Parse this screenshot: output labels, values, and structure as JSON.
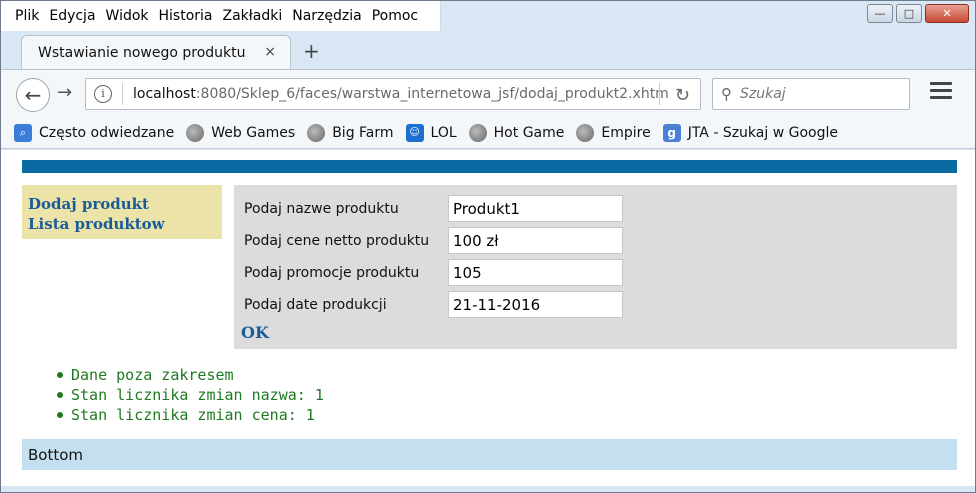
{
  "menubar": {
    "items": [
      "Plik",
      "Edycja",
      "Widok",
      "Historia",
      "Zakładki",
      "Narzędzia",
      "Pomoc"
    ]
  },
  "window_controls": {
    "minimize": "—",
    "maximize": "□",
    "close": "✕"
  },
  "tab": {
    "title": "Wstawianie nowego produktu",
    "close": "×",
    "new_tab": "+"
  },
  "navbar": {
    "url_host": "localhost",
    "url_rest": ":8080/Sklep_6/faces/warstwa_internetowa_jsf/dodaj_produkt2.xhtm",
    "search_placeholder": "Szukaj"
  },
  "bookmarks": [
    {
      "label": "Często odwiedzane",
      "icon": "most-visited-icon"
    },
    {
      "label": "Web Games",
      "icon": "globe-icon"
    },
    {
      "label": "Big Farm",
      "icon": "globe-icon"
    },
    {
      "label": "LOL",
      "icon": "lol-icon"
    },
    {
      "label": "Hot Game",
      "icon": "globe-icon"
    },
    {
      "label": "Empire",
      "icon": "globe-icon"
    },
    {
      "label": "JTA - Szukaj w Google",
      "icon": "google-icon"
    }
  ],
  "leftnav": {
    "add_product": "Dodaj produkt",
    "product_list": "Lista produktow"
  },
  "form": {
    "name_label": "Podaj nazwe produktu",
    "name_value": "Produkt1",
    "price_label": "Podaj cene netto produktu",
    "price_value": "100 zł",
    "promo_label": "Podaj promocje produktu",
    "promo_value": "105",
    "date_label": "Podaj date produkcji",
    "date_value": "21-11-2016",
    "ok": "OK"
  },
  "messages": [
    "Dane poza zakresem",
    "Stan licznika zmian nazwa: 1",
    "Stan licznika zmian cena: 1"
  ],
  "footer": {
    "text": "Bottom"
  },
  "colors": {
    "top_bar": "#0b6aa2",
    "leftnav_bg": "#ece3a8",
    "form_bg": "#dcdcdc",
    "message": "#1f7a1f",
    "footer_bg": "#c4e0f0",
    "link": "#1a5c98"
  }
}
